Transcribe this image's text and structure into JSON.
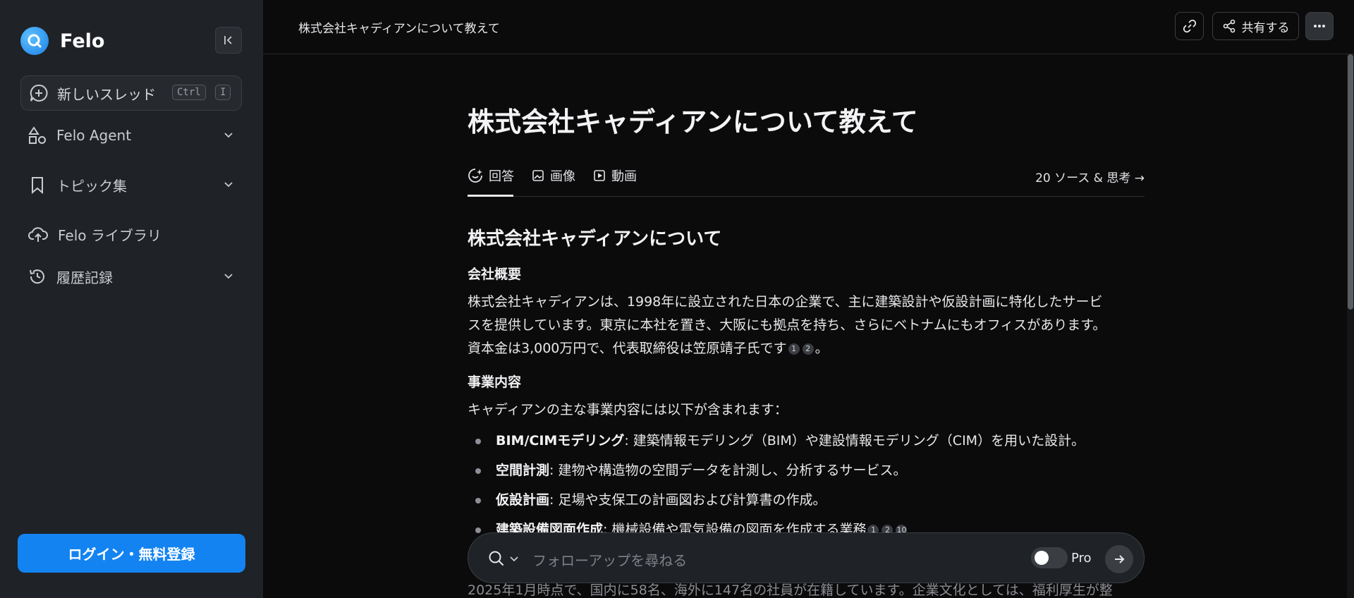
{
  "sidebar": {
    "brand": "Felo",
    "new_thread": {
      "label": "新しいスレッド",
      "kbd_ctrl": "Ctrl",
      "kbd_key": "I"
    },
    "items": [
      {
        "label": "Felo Agent"
      },
      {
        "label": "トピック集"
      },
      {
        "label": "Felo ライブラリ"
      },
      {
        "label": "履歴記録"
      }
    ],
    "login_label": "ログイン・無料登録"
  },
  "topbar": {
    "title": "株式会社キャディアンについて教えて",
    "share_label": "共有する"
  },
  "main": {
    "title": "株式会社キャディアンについて教えて",
    "tabs": [
      {
        "label": "回答"
      },
      {
        "label": "画像"
      },
      {
        "label": "動画"
      }
    ],
    "sources_link": "20 ソース & 思考 →",
    "article": {
      "h2": "株式会社キャディアンについて",
      "section1_heading": "会社概要",
      "section1_line1": "株式会社キャディアンは、1998年に設立された日本の企業で、主に建築設計や仮設計画に特化したサービ",
      "section1_line2": "スを提供しています。東京に本社を置き、大阪にも拠点を持ち、さらにベトナムにもオフィスがあります。",
      "section1_line3": "資本金は3,000万円で、代表取締役は笠原靖子氏です",
      "section1_cites": [
        "1",
        "2"
      ],
      "section1_tail": "。",
      "section2_heading": "事業内容",
      "section2_intro": "キャディアンの主な事業内容には以下が含まれます：",
      "bullets": [
        {
          "term": "BIM/CIMモデリング",
          "desc": ": 建築情報モデリング（BIM）や建設情報モデリング（CIM）を用いた設計。"
        },
        {
          "term": "空間計測",
          "desc": ": 建物や構造物の空間データを計測し、分析するサービス。"
        },
        {
          "term": "仮設計画",
          "desc": ": 足場や支保工の計画図および計算書の作成。"
        },
        {
          "term": "建築設備図面作成",
          "desc": ": 機械設備や電気設備の図面を作成する業務"
        }
      ],
      "bullet4_cites": [
        "1",
        "2",
        "10"
      ],
      "faded_text": "2025年1月時点で、国内に58名、海外に147名の社員が在籍しています。企業文化としては、福利厚生が整"
    },
    "followup": {
      "placeholder": "フォローアップを尋ねる",
      "pro_label": "Pro"
    }
  },
  "colors": {
    "accent": "#1483f2",
    "sidebar_bg": "#1f2226",
    "page_bg": "#0b0b0c"
  }
}
